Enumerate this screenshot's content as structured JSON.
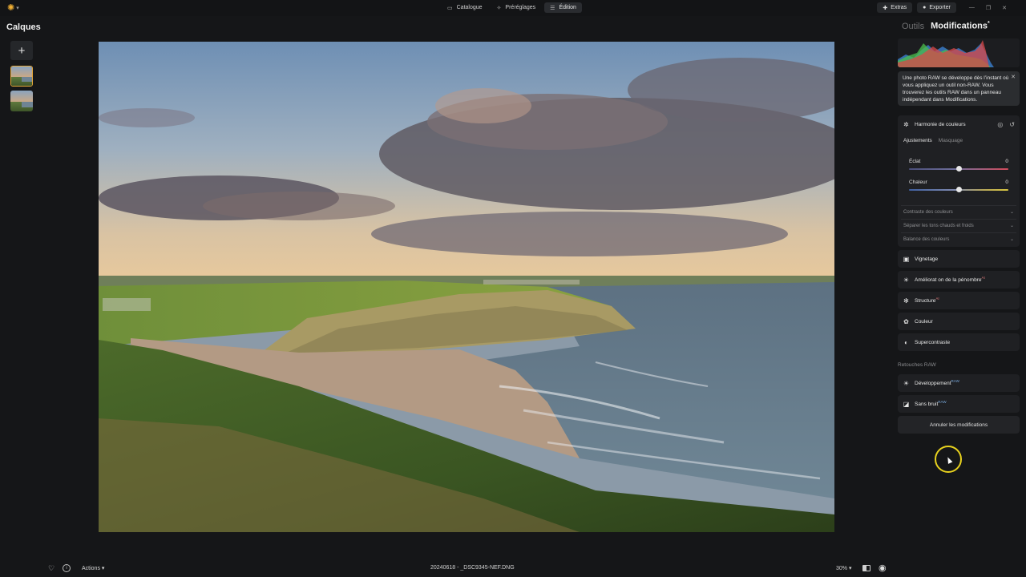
{
  "topbar": {
    "modes": [
      {
        "label": "Catalogue",
        "icon": "folder-icon"
      },
      {
        "label": "Préréglages",
        "icon": "sparkle-icon"
      },
      {
        "label": "Édition",
        "icon": "sliders-icon",
        "active": true
      }
    ],
    "extras_label": "Extras",
    "export_label": "Exporter"
  },
  "layers": {
    "title": "Calques",
    "add_label": "+"
  },
  "bottombar": {
    "actions_label": "Actions",
    "filename": "20240618 - _DSC9345-NEF.DNG",
    "zoom": "30%"
  },
  "right_panel": {
    "tabs": [
      {
        "label": "Outils",
        "active": false
      },
      {
        "label": "Modifications",
        "active": true
      }
    ],
    "raw_tip": "Une photo RAW se développe dès l’instant où vous appliquez un outil non-RAW. Vous trouverez les outils RAW dans un panneau indépendant dans Modifications.",
    "harmony": {
      "title": "Harmonie de couleurs",
      "subtabs": [
        "Ajustements",
        "Masquage"
      ],
      "sliders": [
        {
          "label": "Éclat",
          "value": "0",
          "position": 0.5
        },
        {
          "label": "Chaleur",
          "value": "0",
          "position": 0.5
        }
      ],
      "sections": [
        "Contraste des couleurs",
        "Séparer les tons chauds et froids",
        "Balance des couleurs"
      ]
    },
    "tools": [
      {
        "label": "Vignetage",
        "icon": "vignette-icon",
        "badge": ""
      },
      {
        "label": "Améliorat on de la pénombre",
        "icon": "sun-icon",
        "badge": "AI"
      },
      {
        "label": "Structure",
        "icon": "structure-icon",
        "badge": "AI"
      },
      {
        "label": "Couleur",
        "icon": "palette-icon",
        "badge": ""
      },
      {
        "label": "Supercontraste",
        "icon": "contrast-icon",
        "badge": ""
      }
    ],
    "raw_section_label": "Retouches RAW",
    "raw_tools": [
      {
        "label": "Développement",
        "icon": "sun-icon",
        "badge": "RAW"
      },
      {
        "label": "Sans bruit",
        "icon": "denoise-icon",
        "badge": "RAW"
      }
    ],
    "cancel_label": "Annuler les modifications"
  },
  "colors": {
    "accent": "#e2a63a",
    "cursor_ring": "#e8d21e",
    "panel_bg": "#1f2023"
  }
}
